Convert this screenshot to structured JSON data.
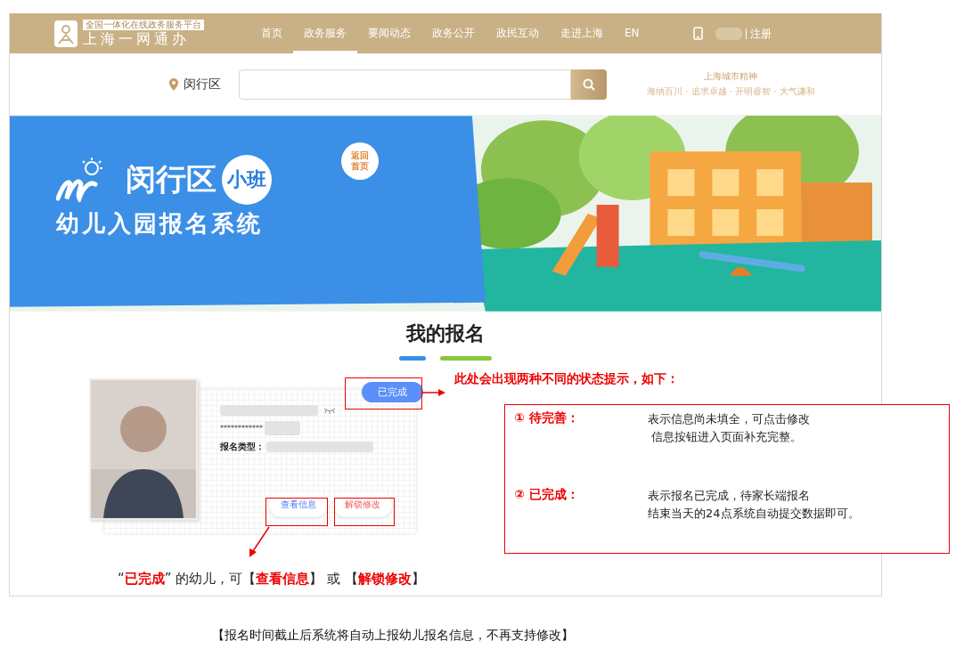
{
  "header": {
    "logo_tagline": "全国一体化在线政务服务平台",
    "logo_name": "上海一网通办",
    "nav": [
      {
        "label": "首页",
        "selected": false
      },
      {
        "label": "政务服务",
        "selected": true
      },
      {
        "label": "要闻动态",
        "selected": false
      },
      {
        "label": "政务公开",
        "selected": false
      },
      {
        "label": "政民互动",
        "selected": false
      },
      {
        "label": "走进上海",
        "selected": false
      },
      {
        "label": "EN",
        "selected": false
      }
    ],
    "register": "注册"
  },
  "search": {
    "location": "闵行区"
  },
  "city_spirit": {
    "title": "上海城市精神",
    "motto": "海纳百川 · 追求卓越 · 开明睿智 · 大气谦和"
  },
  "banner": {
    "title": "闵行区",
    "badge": "小班",
    "subtitle": "幼儿入园报名系统",
    "back_bubble": "返回首页"
  },
  "section": {
    "title": "我的报名"
  },
  "card": {
    "masked_id": "************",
    "type_label": "报名类型：",
    "status": "已完成",
    "buttons": [
      {
        "label": "查看信息",
        "kind": "view"
      },
      {
        "label": "解锁修改",
        "kind": "unlock"
      }
    ]
  },
  "annotations": {
    "status_note": "此处会出现两种不同的状态提示，如下：",
    "states": [
      {
        "label": "① 待完善：",
        "description_lines": [
          "表示信息尚未填全，可点击修改",
          "信息按钮进入页面补充完整。"
        ]
      },
      {
        "label": "② 已完成：",
        "description_lines": [
          "表示报名已完成，待家长端报名",
          "结束当天的24点系统自动提交数据即可。"
        ]
      }
    ],
    "card_note": "“**已完成**” 的幼儿，可【**查看信息**】 或 【**解锁修改**】"
  },
  "caption": "【报名时间截止后系统将自动上报幼儿报名信息，不再支持修改】"
}
